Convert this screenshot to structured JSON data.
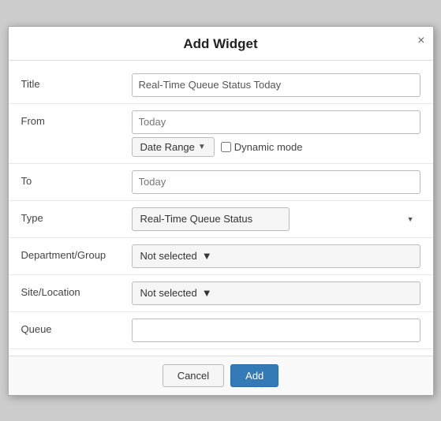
{
  "dialog": {
    "title": "Add Widget",
    "close_label": "×"
  },
  "form": {
    "title_label": "Title",
    "title_value": "Real-Time Queue Status Today",
    "from_label": "From",
    "from_placeholder": "Today",
    "date_range_label": "Date Range",
    "dynamic_mode_label": "Dynamic mode",
    "to_label": "To",
    "to_placeholder": "Today",
    "type_label": "Type",
    "type_value": "Real-Time Queue Status",
    "department_label": "Department/Group",
    "department_value": "Not selected",
    "site_label": "Site/Location",
    "site_value": "Not selected",
    "queue_label": "Queue",
    "queue_value": ""
  },
  "footer": {
    "cancel_label": "Cancel",
    "add_label": "Add"
  }
}
